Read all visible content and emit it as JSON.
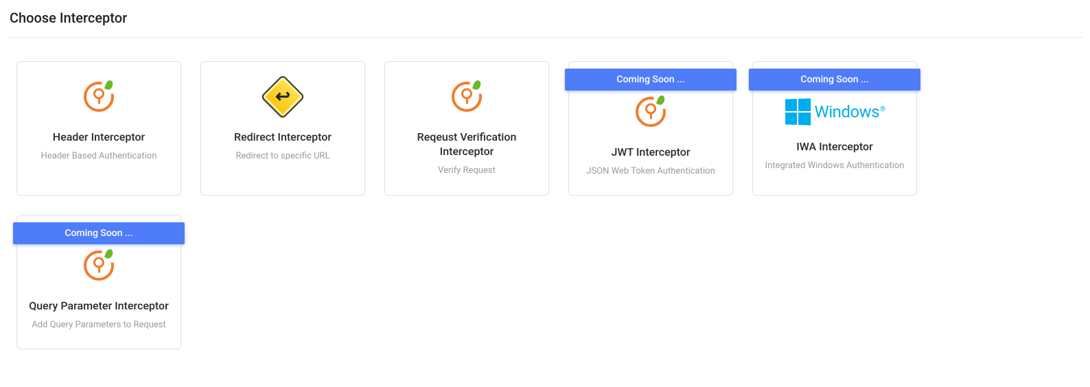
{
  "title": "Choose Interceptor",
  "coming_soon": "Coming Soon ...",
  "cards": [
    {
      "title": "Header Interceptor",
      "desc": "Header Based Authentication"
    },
    {
      "title": "Redirect Interceptor",
      "desc": "Redirect to specific URL"
    },
    {
      "title": "Reqeust Verification Interceptor",
      "desc": "Verify Request"
    },
    {
      "title": "JWT Interceptor",
      "desc": "JSON Web Token Authentication"
    },
    {
      "title": "IWA Interceptor",
      "desc": "Integrated Windows Authentication"
    },
    {
      "title": "Query Parameter Interceptor",
      "desc": "Add Query Parameters to Request"
    }
  ],
  "windows_label": "Windows",
  "windows_reg": "®"
}
